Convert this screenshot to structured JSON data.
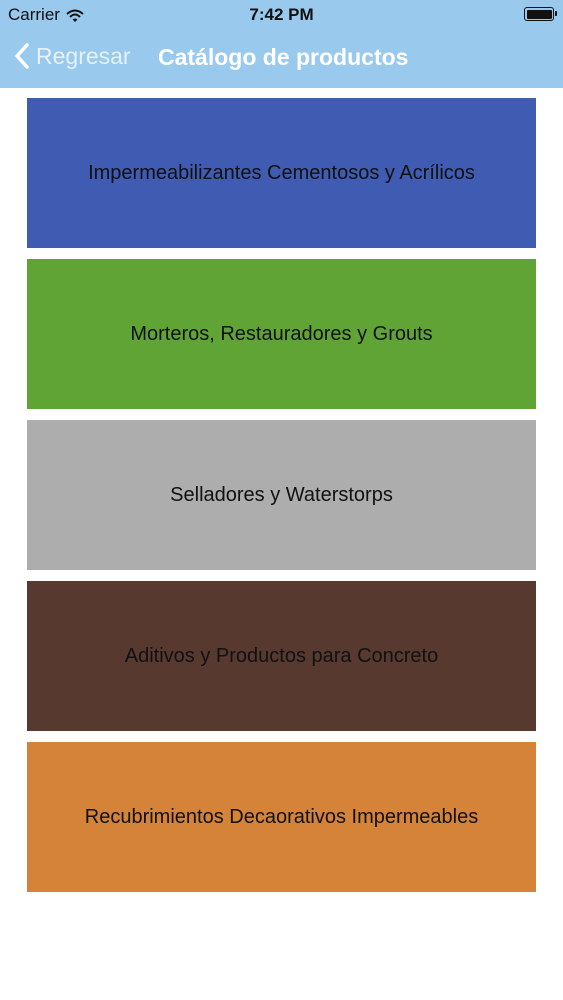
{
  "status_bar": {
    "carrier": "Carrier",
    "time": "7:42 PM",
    "wifi_icon": "wifi-icon",
    "battery_icon": "battery-icon"
  },
  "nav": {
    "back_label": "Regresar",
    "back_icon": "chevron-left-icon",
    "title": "Catálogo de productos",
    "bar_color": "#99c9ec"
  },
  "categories": [
    {
      "label": "Impermeabilizantes Cementosos y Acrílicos",
      "color": "#3f5bb2"
    },
    {
      "label": "Morteros, Restauradores y Grouts",
      "color": "#61a436"
    },
    {
      "label": "Selladores y Waterstorps",
      "color": "#adadad"
    },
    {
      "label": "Aditivos y Productos para Concreto",
      "color": "#573930"
    },
    {
      "label": "Recubrimientos Decaorativos Impermeables",
      "color": "#d48339"
    }
  ]
}
